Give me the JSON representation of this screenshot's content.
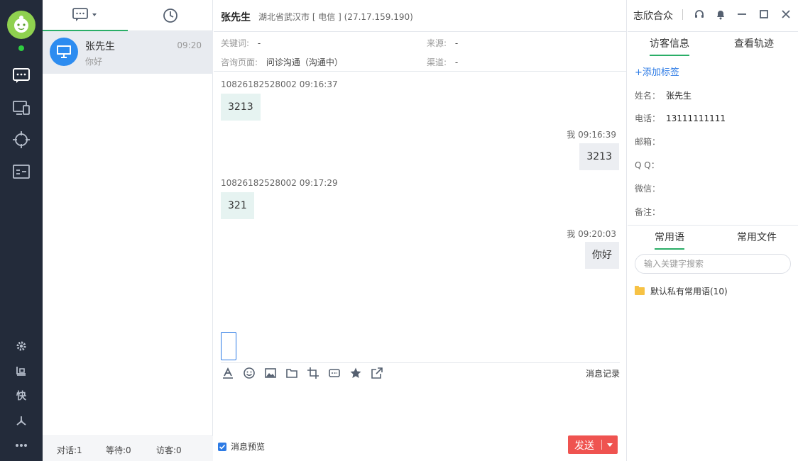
{
  "visitor": {
    "name": "张先生",
    "location": "湖北省武汉市 [ 电信 ] (27.17.159.190)"
  },
  "window": {
    "title": "志欣合众"
  },
  "conversation_list": {
    "items": [
      {
        "name": "张先生",
        "time": "09:20",
        "preview": "你好"
      }
    ],
    "footer": {
      "dialogs": "对话:1",
      "waiting": "等待:0",
      "visitors": "访客:0"
    }
  },
  "info_bar": {
    "keyword_label": "关键词:",
    "keyword_value": "-",
    "source_label": "来源:",
    "source_value": "-",
    "page_label": "咨询页面:",
    "page_value": "问诊沟通（沟通中）",
    "channel_label": "渠道:",
    "channel_value": "-"
  },
  "messages": [
    {
      "meta": "10826182528002 09:16:37",
      "text": "3213",
      "dir": "in"
    },
    {
      "meta": "我 09:16:39",
      "text": "3213",
      "dir": "out"
    },
    {
      "meta": "10826182528002 09:17:29",
      "text": "321",
      "dir": "in"
    },
    {
      "meta": "我 09:20:03",
      "text": "你好",
      "dir": "out"
    }
  ],
  "composer": {
    "history_label": "消息记录",
    "preview_label": "消息预览",
    "preview_checked": true,
    "send_label": "发送"
  },
  "right_panel": {
    "tabs": [
      "访客信息",
      "查看轨迹"
    ],
    "add_tag": "+添加标签",
    "fields": [
      {
        "key": "姓名：",
        "value": "张先生"
      },
      {
        "key": "电话：",
        "value": "13111111111"
      },
      {
        "key": "邮箱：",
        "value": ""
      },
      {
        "key": "Q Q：",
        "value": ""
      },
      {
        "key": "微信：",
        "value": ""
      },
      {
        "key": "备注：",
        "value": ""
      }
    ],
    "bottom_tabs": [
      "常用语",
      "常用文件"
    ],
    "search_placeholder": "输入关键字搜索",
    "folder_label": "默认私有常用语(10)"
  },
  "rail": {
    "shortcut_label": "快"
  },
  "colors": {
    "rail_bg": "#232b3a",
    "accent_green": "#2aae67",
    "send_red": "#ef5350",
    "link_blue": "#2d7be5"
  }
}
